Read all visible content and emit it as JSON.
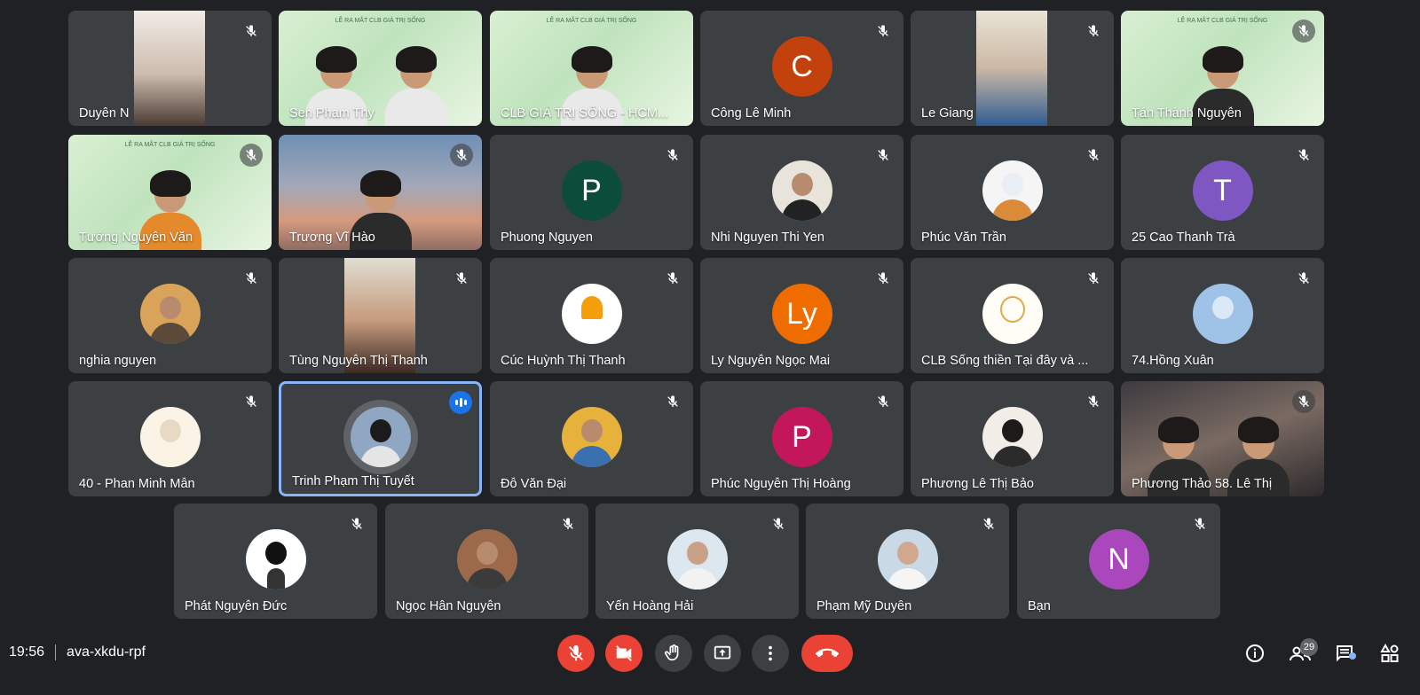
{
  "participants": [
    {
      "name": "Duyên N",
      "avatar_letter": "",
      "avatar_color": "",
      "tile_style": "portrait"
    },
    {
      "name": "Sen Pham Thy",
      "avatar_letter": "",
      "avatar_color": "",
      "tile_style": "green-pair"
    },
    {
      "name": "CLB GIÁ TRỊ SỐNG - HCM...",
      "avatar_letter": "",
      "avatar_color": "",
      "tile_style": "green"
    },
    {
      "name": "Công Lê Minh",
      "avatar_letter": "C",
      "avatar_color": "#c2410c",
      "tile_style": "letter"
    },
    {
      "name": "Le Giang",
      "avatar_letter": "",
      "avatar_color": "",
      "tile_style": "portrait"
    },
    {
      "name": "Tán Thành Nguyễn",
      "avatar_letter": "",
      "avatar_color": "",
      "tile_style": "green"
    },
    {
      "name": "Tướng Nguyễn Văn",
      "avatar_letter": "",
      "avatar_color": "",
      "tile_style": "green-orange"
    },
    {
      "name": "Trương Vĩ Hào",
      "avatar_letter": "",
      "avatar_color": "",
      "tile_style": "sky"
    },
    {
      "name": "Phuong Nguyen",
      "avatar_letter": "P",
      "avatar_color": "#0b4d3a",
      "tile_style": "letter"
    },
    {
      "name": "Nhi Nguyen Thi Yen",
      "avatar_letter": "",
      "avatar_color": "",
      "tile_style": "photo"
    },
    {
      "name": "Phúc Văn Trần",
      "avatar_letter": "",
      "avatar_color": "",
      "tile_style": "photo"
    },
    {
      "name": "25 Cao Thanh Trà",
      "avatar_letter": "T",
      "avatar_color": "#7e57c2",
      "tile_style": "letter"
    },
    {
      "name": "nghia nguyen",
      "avatar_letter": "",
      "avatar_color": "",
      "tile_style": "photo"
    },
    {
      "name": "Tùng Nguyễn Thị Thanh",
      "avatar_letter": "",
      "avatar_color": "",
      "tile_style": "portrait"
    },
    {
      "name": "Cúc Huỳnh Thị Thanh",
      "avatar_letter": "",
      "avatar_color": "",
      "tile_style": "photo"
    },
    {
      "name": "Ly Nguyễn Ngọc Mai",
      "avatar_letter": "Ly",
      "avatar_color": "#ef6c00",
      "tile_style": "letter"
    },
    {
      "name": "CLB Sống thiền Tại đây và ...",
      "avatar_letter": "",
      "avatar_color": "",
      "tile_style": "photo"
    },
    {
      "name": "74.Hồng Xuân",
      "avatar_letter": "",
      "avatar_color": "",
      "tile_style": "photo"
    },
    {
      "name": "40 - Phan Minh Mẫn",
      "avatar_letter": "",
      "avatar_color": "",
      "tile_style": "photo"
    },
    {
      "name": "Trinh Phạm Thị Tuyết",
      "avatar_letter": "",
      "avatar_color": "",
      "tile_style": "photo-speaking"
    },
    {
      "name": "Đỗ Văn Đại",
      "avatar_letter": "",
      "avatar_color": "",
      "tile_style": "photo"
    },
    {
      "name": "Phúc Nguyễn Thị Hoàng",
      "avatar_letter": "P",
      "avatar_color": "#c2185b",
      "tile_style": "letter"
    },
    {
      "name": "Phương Lê Thị Bảo",
      "avatar_letter": "",
      "avatar_color": "",
      "tile_style": "photo"
    },
    {
      "name": "Phương Thảo 58. Lê Thị",
      "avatar_letter": "",
      "avatar_color": "",
      "tile_style": "dark-pair"
    },
    {
      "name": "Phát Nguyễn Đức",
      "avatar_letter": "",
      "avatar_color": "",
      "tile_style": "photo"
    },
    {
      "name": "Ngọc Hân Nguyễn",
      "avatar_letter": "",
      "avatar_color": "",
      "tile_style": "photo"
    },
    {
      "name": "Yến Hoàng Hải",
      "avatar_letter": "",
      "avatar_color": "",
      "tile_style": "photo"
    },
    {
      "name": "Phạm Mỹ Duyên",
      "avatar_letter": "",
      "avatar_color": "",
      "tile_style": "photo"
    },
    {
      "name": "Bạn",
      "avatar_letter": "N",
      "avatar_color": "#ab47bc",
      "tile_style": "letter"
    }
  ],
  "meeting": {
    "time": "19:56",
    "code": "ava-xkdu-rpf"
  },
  "people_count": "29",
  "banner_text": "LỄ RA MẮT CLB GIÁ TRỊ SỐNG",
  "controls": [
    "mic-off",
    "camera-off",
    "raise-hand",
    "present",
    "more",
    "leave-call"
  ],
  "right_controls": [
    "info",
    "people",
    "chat",
    "activities"
  ],
  "colors": {
    "background": "#202124",
    "tile": "#3c4043",
    "red": "#ea4335",
    "active_border": "#8ab4f8",
    "accent": "#1a73e8"
  }
}
